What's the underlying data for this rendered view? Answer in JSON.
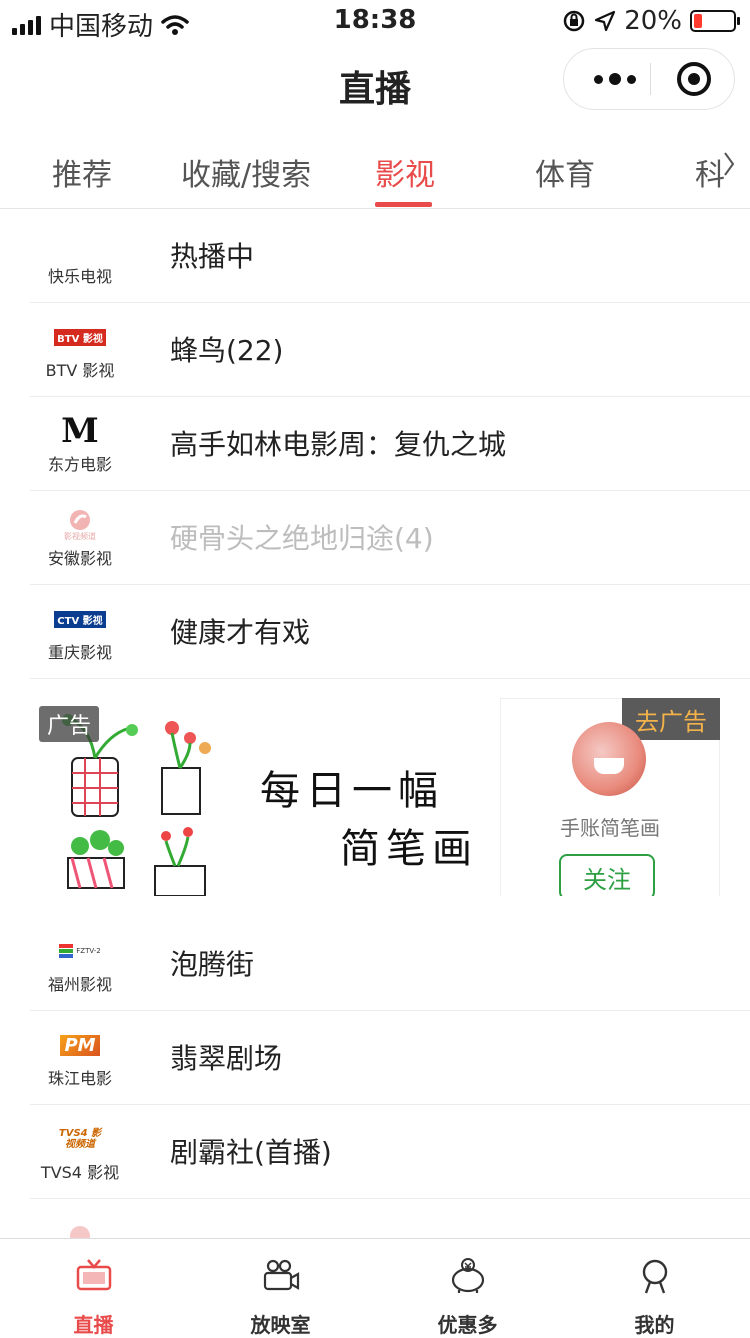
{
  "status_bar": {
    "carrier": "中国移动",
    "time": "18:38",
    "battery_percent": "20%",
    "battery_level": 0.2,
    "battery_color": "#ff3b30",
    "icons": [
      "signal-icon",
      "wifi-icon",
      "rotation-lock-icon",
      "location-arrow-icon",
      "battery-icon"
    ]
  },
  "nav": {
    "title": "直播",
    "menu_icon": "more-dots-icon",
    "close_icon": "target-close-icon"
  },
  "tabs": {
    "items": [
      {
        "label": "推荐",
        "active": false
      },
      {
        "label": "收藏/搜索",
        "active": false
      },
      {
        "label": "影视",
        "active": true
      },
      {
        "label": "体育",
        "active": false
      },
      {
        "label": "科",
        "active": false
      }
    ],
    "more_icon": "chevron-right-icon",
    "accent_color": "#e94b4b"
  },
  "channels": [
    {
      "channel": "快乐电视",
      "program": "热播中",
      "dimmed": false
    },
    {
      "channel": "BTV 影视",
      "program": "蜂鸟(22)",
      "dimmed": false,
      "logo_text": "BTV 影视"
    },
    {
      "channel": "东方电影",
      "program": "高手如林电影周：复仇之城",
      "dimmed": false,
      "logo_text": "M"
    },
    {
      "channel": "安徽影视",
      "program": "硬骨头之绝地归途(4)",
      "dimmed": true,
      "logo_text": "影视频道"
    },
    {
      "channel": "重庆影视",
      "program": "健康才有戏",
      "dimmed": false,
      "logo_text": "CTV 影视"
    }
  ],
  "ad": {
    "tag": "广告",
    "headline_1": "每日一幅",
    "headline_2": "简笔画",
    "remove_label": "去广告",
    "account_name": "手账简笔画",
    "follow_label": "关注"
  },
  "channels_2": [
    {
      "channel": "福州影视",
      "program": "泡腾街",
      "dimmed": false,
      "logo_text": "FZTV-2"
    },
    {
      "channel": "珠江电影",
      "program": "翡翠剧场",
      "dimmed": false,
      "logo_text": "PM"
    },
    {
      "channel": "TVS4 影视",
      "program": "剧霸社(首播)",
      "dimmed": false,
      "logo_text": "TVS4 影视频道"
    }
  ],
  "tabbar": {
    "items": [
      {
        "label": "直播",
        "icon": "tv-icon",
        "active": true
      },
      {
        "label": "放映室",
        "icon": "camera-icon",
        "active": false
      },
      {
        "label": "优惠多",
        "icon": "piggy-bank-icon",
        "active": false
      },
      {
        "label": "我的",
        "icon": "user-icon",
        "active": false
      }
    ]
  }
}
